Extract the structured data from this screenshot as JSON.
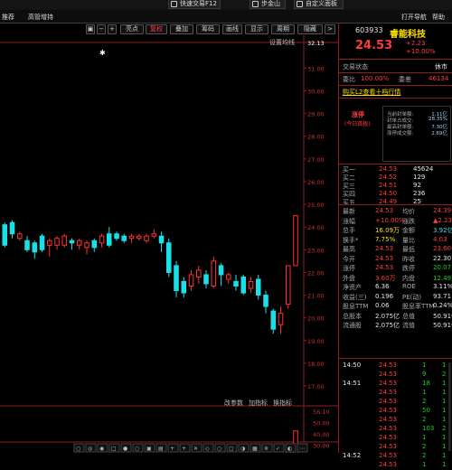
{
  "topbar": {
    "btn1": "快速交易F12",
    "btn2": "步金山",
    "btn3": "自定义面板"
  },
  "menu": {
    "m1": "推荐",
    "m2": "高管增持",
    "m3": "打开导航",
    "m4": "帮助"
  },
  "toolbar": {
    "t1": "亮点",
    "t2": "复权",
    "t3": "叠加",
    "t4": "筹码",
    "t5": "画线",
    "t6": "显示",
    "t7": "周期",
    "t8": "隐藏",
    "rb1": "设置均线",
    "minus": "−",
    "plus": "+"
  },
  "price_axis": [
    "32.13",
    "31.00",
    "30.00",
    "29.00",
    "28.00",
    "27.00",
    "26.00",
    "25.00",
    "24.00",
    "23.00",
    "22.00",
    "21.00",
    "20.00",
    "19.00",
    "18.00",
    "17.00"
  ],
  "vol_axis": [
    "56.10",
    "50.00",
    "40.00",
    "30.00",
    "20.00",
    "10.00",
    "×万"
  ],
  "subchart": {
    "a": "改参数",
    "b": "加指标",
    "c": "换指标"
  },
  "bottom_tabs": [
    "○",
    "◎",
    "◉",
    "□",
    "●",
    "○",
    "▣",
    "▤",
    "+",
    "+",
    "✕",
    "◇",
    "○",
    "▢",
    "◑",
    "▦",
    "※",
    "✓",
    "◐",
    "⋯"
  ],
  "stock": {
    "code": "603933",
    "name": "睿能科技",
    "price": "24.53",
    "chg": "+2.23",
    "pct": "+10.00%"
  },
  "status": {
    "label": "交易状态",
    "value": "休市"
  },
  "weibi": {
    "l1": "委比",
    "v1": "100.00%",
    "l2": "委差",
    "v2": "46134"
  },
  "l2link": "购买L2查看十档行情",
  "limitbox": {
    "title1": "涨停",
    "title2": "(今日首板)",
    "rows": [
      [
        "当前封单额:",
        "1.11亿"
      ],
      [
        "封单占成交:",
        "28.35%"
      ],
      [
        "最高封单额:",
        "7.30亿"
      ],
      [
        "涨停成交额:",
        "2.69亿"
      ]
    ]
  },
  "sells": [
    {
      "l": "卖五",
      "p": "",
      "v": ""
    },
    {
      "l": "卖四",
      "p": "",
      "v": ""
    },
    {
      "l": "卖三",
      "p": "",
      "v": ""
    },
    {
      "l": "卖二",
      "p": "",
      "v": ""
    },
    {
      "l": "卖一",
      "p": "",
      "v": ""
    }
  ],
  "buys": [
    {
      "l": "买一",
      "p": "24.53",
      "v": "45624"
    },
    {
      "l": "买二",
      "p": "24.52",
      "v": "129"
    },
    {
      "l": "买三",
      "p": "24.51",
      "v": "92"
    },
    {
      "l": "买四",
      "p": "24.50",
      "v": "236"
    },
    {
      "l": "买五",
      "p": "24.49",
      "v": "25"
    }
  ],
  "quote": [
    {
      "l1": "最新",
      "v1": "24.53",
      "c1": "red",
      "l2": "均价",
      "v2": "24.39",
      "c2": "red"
    },
    {
      "l1": "涨幅",
      "v1": "+10.00%",
      "c1": "red",
      "l2": "涨跌",
      "v2": "▲2.23",
      "c2": "red"
    },
    {
      "l1": "总手",
      "v1": "16.09万",
      "c1": "yel",
      "l2": "金额",
      "v2": "3.92亿",
      "c2": "cyn"
    },
    {
      "l1": "换手*",
      "v1": "7.75%",
      "c1": "yel",
      "l2": "量比",
      "v2": "4.03",
      "c2": "red"
    },
    {
      "l1": "最高",
      "v1": "24.53",
      "c1": "red",
      "l2": "最低",
      "v2": "23.60",
      "c2": "red"
    },
    {
      "l1": "今开",
      "v1": "24.53",
      "c1": "red",
      "l2": "昨收",
      "v2": "22.30",
      "c2": "wht"
    },
    {
      "l1": "涨停",
      "v1": "24.53",
      "c1": "red",
      "l2": "跌停",
      "v2": "20.07",
      "c2": "grn"
    },
    {
      "l1": "外盘",
      "v1": "3.60万",
      "c1": "red",
      "l2": "内盘",
      "v2": "12.49万",
      "c2": "grn"
    },
    {
      "l1": "净资产",
      "v1": "6.36",
      "c1": "wht",
      "l2": "ROE",
      "v2": "3.11%",
      "c2": "wht"
    },
    {
      "l1": "收益(三)",
      "v1": "0.196",
      "c1": "wht",
      "l2": "PE(动)",
      "v2": "93.71",
      "c2": "wht"
    },
    {
      "l1": "股息TTM",
      "v1": "0.06",
      "c1": "wht",
      "l2": "股息率TTM",
      "v2": "0.24%",
      "c2": "wht"
    },
    {
      "l1": "总股本",
      "v1": "2.075亿",
      "c1": "wht",
      "l2": "总值",
      "v2": "50.91亿",
      "c2": "wht"
    },
    {
      "l1": "流通股",
      "v1": "2.075亿",
      "c1": "wht",
      "l2": "流值",
      "v2": "50.91亿",
      "c2": "wht"
    }
  ],
  "trades": [
    {
      "t": "14:50",
      "p": "24.53",
      "v": "1",
      "n": "1"
    },
    {
      "t": "",
      "p": "24.53",
      "v": "9",
      "n": "2"
    },
    {
      "t": "14:51",
      "p": "24.53",
      "v": "18",
      "n": "1"
    },
    {
      "t": "",
      "p": "24.53",
      "v": "1",
      "n": "1"
    },
    {
      "t": "",
      "p": "24.53",
      "v": "2",
      "n": "1"
    },
    {
      "t": "",
      "p": "24.53",
      "v": "50",
      "n": "1"
    },
    {
      "t": "",
      "p": "24.53",
      "v": "2",
      "n": "1"
    },
    {
      "t": "",
      "p": "24.53",
      "v": "103",
      "n": "2"
    },
    {
      "t": "",
      "p": "24.53",
      "v": "1",
      "n": "1"
    },
    {
      "t": "",
      "p": "24.53",
      "v": "2",
      "n": "1"
    },
    {
      "t": "14:52",
      "p": "24.53",
      "v": "2",
      "n": "1"
    },
    {
      "t": "",
      "p": "24.53",
      "v": "1",
      "n": "1"
    }
  ],
  "chart_data": {
    "type": "candlestick",
    "price_range": [
      17,
      32.13
    ],
    "volume_range": [
      0,
      56.1
    ],
    "candles": [
      {
        "o": 23.2,
        "c": 24.1,
        "h": 24.2,
        "l": 23.1,
        "up": false
      },
      {
        "o": 23.7,
        "c": 24.2,
        "h": 24.3,
        "l": 23.5,
        "up": false
      },
      {
        "o": 23.5,
        "c": 23.7,
        "h": 23.8,
        "l": 23.4,
        "up": true
      },
      {
        "o": 23.4,
        "c": 23.0,
        "h": 23.6,
        "l": 22.9,
        "up": false
      },
      {
        "o": 22.9,
        "c": 23.3,
        "h": 23.4,
        "l": 22.6,
        "up": false
      },
      {
        "o": 23.6,
        "c": 23.0,
        "h": 23.7,
        "l": 22.9,
        "up": false
      },
      {
        "o": 23.2,
        "c": 23.4,
        "h": 23.5,
        "l": 22.7,
        "up": true
      },
      {
        "o": 23.2,
        "c": 23.5,
        "h": 23.6,
        "l": 23.0,
        "up": true
      },
      {
        "o": 23.2,
        "c": 23.6,
        "h": 23.7,
        "l": 23.1,
        "up": true
      },
      {
        "o": 23.4,
        "c": 23.3,
        "h": 23.5,
        "l": 23.0,
        "up": false
      },
      {
        "o": 23.2,
        "c": 23.4,
        "h": 23.5,
        "l": 23.0,
        "up": true
      },
      {
        "o": 23.1,
        "c": 23.3,
        "h": 23.4,
        "l": 22.8,
        "up": true
      },
      {
        "o": 23.4,
        "c": 23.1,
        "h": 23.5,
        "l": 22.9,
        "up": false
      },
      {
        "o": 23.3,
        "c": 23.6,
        "h": 23.7,
        "l": 23.1,
        "up": true
      },
      {
        "o": 23.2,
        "c": 23.7,
        "h": 24.0,
        "l": 23.1,
        "up": false
      },
      {
        "o": 23.7,
        "c": 23.5,
        "h": 23.8,
        "l": 23.4,
        "up": false
      },
      {
        "o": 23.4,
        "c": 23.6,
        "h": 23.7,
        "l": 23.3,
        "up": false
      },
      {
        "o": 23.6,
        "c": 23.5,
        "h": 23.7,
        "l": 23.3,
        "up": true
      },
      {
        "o": 23.5,
        "c": 23.6,
        "h": 23.7,
        "l": 23.4,
        "up": true
      },
      {
        "o": 23.4,
        "c": 23.6,
        "h": 23.7,
        "l": 23.3,
        "up": true
      },
      {
        "o": 23.6,
        "c": 23.7,
        "h": 23.9,
        "l": 23.5,
        "up": true
      },
      {
        "o": 23.6,
        "c": 23.3,
        "h": 23.8,
        "l": 22.9,
        "up": false
      },
      {
        "o": 23.3,
        "c": 22.0,
        "h": 23.5,
        "l": 21.8,
        "up": false
      },
      {
        "o": 22.3,
        "c": 21.2,
        "h": 22.5,
        "l": 20.9,
        "up": false
      },
      {
        "o": 21.1,
        "c": 21.6,
        "h": 21.8,
        "l": 20.9,
        "up": false
      },
      {
        "o": 21.4,
        "c": 21.9,
        "h": 22.1,
        "l": 21.2,
        "up": true
      },
      {
        "o": 21.8,
        "c": 22.1,
        "h": 22.3,
        "l": 21.5,
        "up": true
      },
      {
        "o": 21.9,
        "c": 21.5,
        "h": 22.1,
        "l": 21.3,
        "up": false
      },
      {
        "o": 21.4,
        "c": 22.5,
        "h": 22.7,
        "l": 21.3,
        "up": true
      },
      {
        "o": 22.3,
        "c": 21.9,
        "h": 22.4,
        "l": 21.4,
        "up": false
      },
      {
        "o": 21.9,
        "c": 21.7,
        "h": 22.0,
        "l": 21.5,
        "up": true
      },
      {
        "o": 21.6,
        "c": 21.4,
        "h": 21.9,
        "l": 21.2,
        "up": false
      },
      {
        "o": 21.8,
        "c": 21.1,
        "h": 21.9,
        "l": 21.0,
        "up": false
      },
      {
        "o": 21.3,
        "c": 21.6,
        "h": 21.8,
        "l": 21.1,
        "up": true
      },
      {
        "o": 21.7,
        "c": 21.0,
        "h": 21.9,
        "l": 20.8,
        "up": false
      },
      {
        "o": 21.0,
        "c": 20.5,
        "h": 21.2,
        "l": 20.2,
        "up": false
      },
      {
        "o": 20.3,
        "c": 19.5,
        "h": 20.4,
        "l": 19.3,
        "up": false
      },
      {
        "o": 19.7,
        "c": 20.2,
        "h": 20.5,
        "l": 19.3,
        "up": true
      },
      {
        "o": 20.6,
        "c": 22.3,
        "h": 22.3,
        "l": 20.4,
        "up": true
      },
      {
        "o": 22.3,
        "c": 24.5,
        "h": 24.5,
        "l": 23.6,
        "up": true
      }
    ],
    "volumes": [
      4,
      6,
      3,
      5,
      3,
      4,
      3,
      3,
      2,
      3,
      3,
      2,
      3,
      4,
      5,
      3,
      2,
      3,
      2,
      3,
      3,
      5,
      6,
      6,
      4,
      3,
      4,
      3,
      5,
      4,
      3,
      3,
      4,
      3,
      4,
      5,
      6,
      8,
      12,
      18
    ]
  }
}
